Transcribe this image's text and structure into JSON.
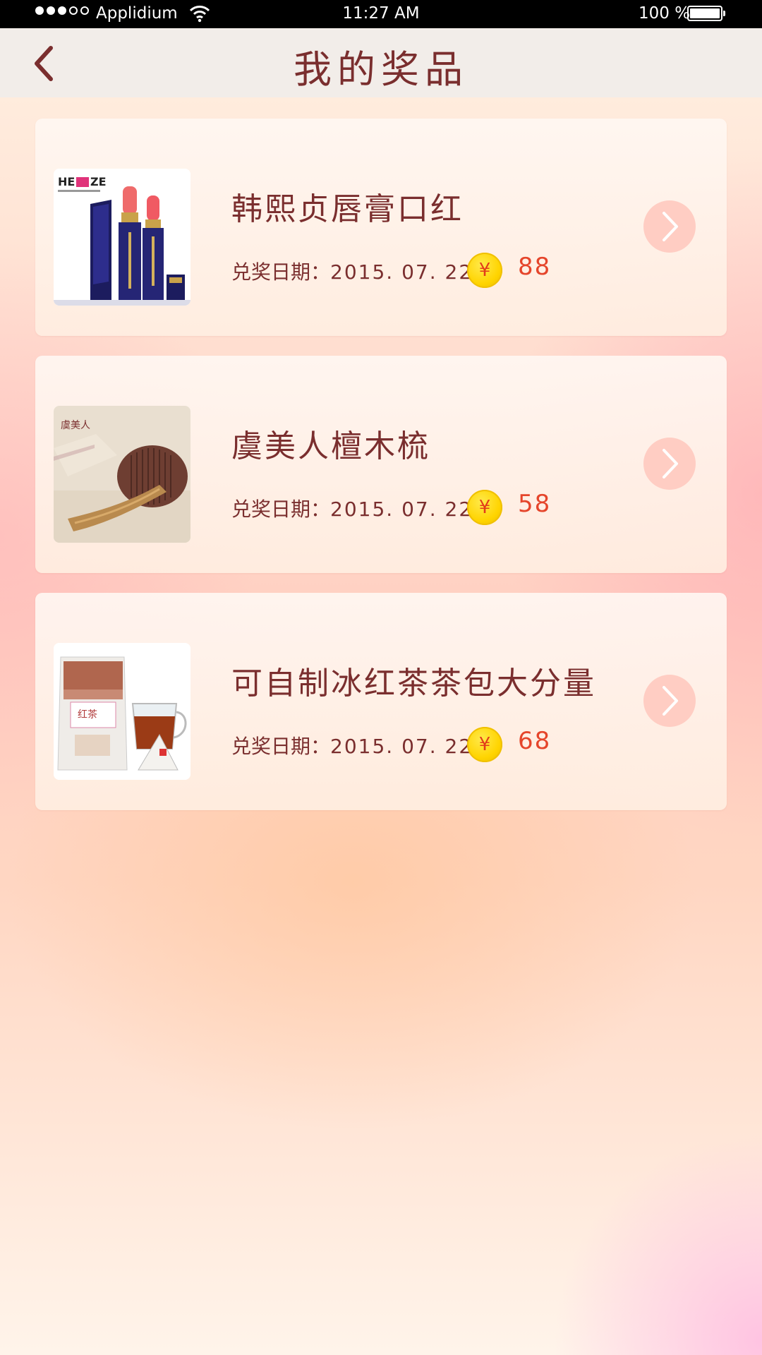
{
  "status_bar": {
    "carrier": "Applidium",
    "time": "11:27 AM",
    "battery": "100 %",
    "signal_icon": "signal-dots-icon",
    "wifi_icon": "wifi-icon",
    "battery_icon": "battery-icon"
  },
  "navbar": {
    "title": "我的奖品",
    "back_icon": "chevron-left-icon"
  },
  "prizes": [
    {
      "name": "韩熙贞唇膏口红",
      "date_label": "兑奖日期：",
      "date": "2015. 07. 22",
      "coin_symbol": "¥",
      "points": "88",
      "image": "lipstick-image",
      "logo_text": "HEXZE"
    },
    {
      "name": "虞美人檀木梳",
      "date_label": "兑奖日期：",
      "date": "2015. 07. 22",
      "coin_symbol": "¥",
      "points": "58",
      "image": "sandalwood-comb-image",
      "logo_text": ""
    },
    {
      "name": "可自制冰红茶茶包大分量",
      "date_label": "兑奖日期：",
      "date": "2015. 07. 22",
      "coin_symbol": "¥",
      "points": "68",
      "image": "tea-bag-image",
      "logo_text": ""
    }
  ],
  "colors": {
    "title": "#7a2e2e",
    "points": "#e5452b",
    "coin": "#ffd400",
    "arrow_button": "#ffcdc3"
  }
}
